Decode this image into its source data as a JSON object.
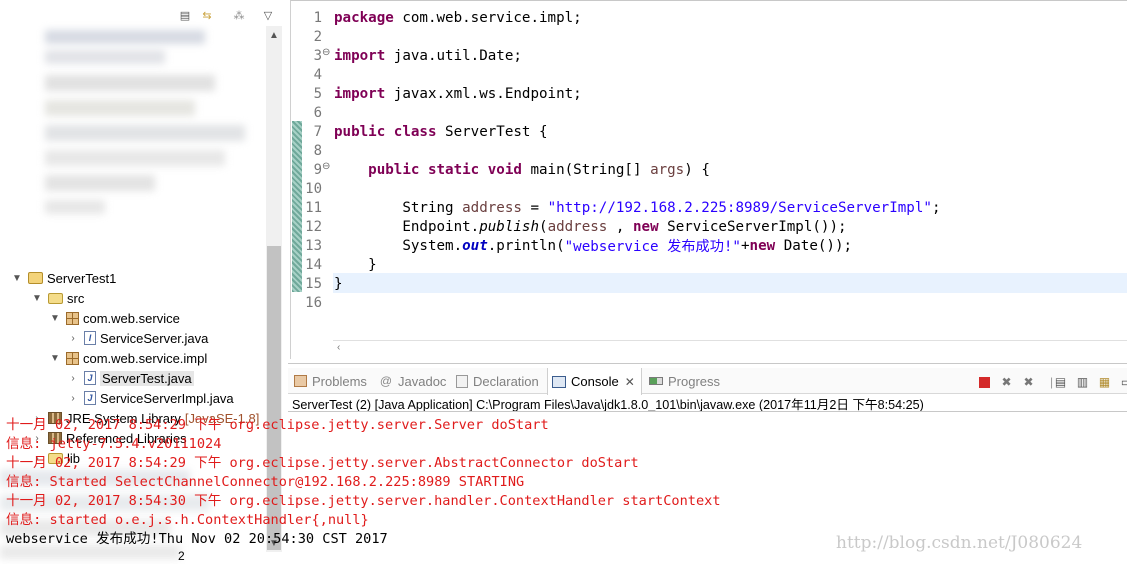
{
  "explorer": {
    "tree": [
      {
        "label": "ServerTest1",
        "icon": "java-project-icon",
        "expanded": true
      },
      {
        "label": "src",
        "icon": "source-folder-icon",
        "expanded": true
      },
      {
        "label": "com.web.service",
        "icon": "package-icon",
        "expanded": true
      },
      {
        "label": "ServiceServer.java",
        "icon": "java-interface-file-icon",
        "expanded": false
      },
      {
        "label": "com.web.service.impl",
        "icon": "package-icon",
        "expanded": true
      },
      {
        "label": "ServerTest.java",
        "icon": "java-file-icon",
        "expanded": false,
        "selected": true
      },
      {
        "label": "ServiceServerImpl.java",
        "icon": "java-file-icon",
        "expanded": false
      },
      {
        "label": "JRE System Library",
        "tag": "[JavaSE-1.8]",
        "icon": "library-icon",
        "expanded": false
      },
      {
        "label": "Referenced Libraries",
        "icon": "library-icon",
        "expanded": false
      },
      {
        "label": "lib",
        "icon": "folder-icon",
        "expanded": false
      }
    ],
    "partial_label": "2"
  },
  "editor": {
    "lines": [
      "1",
      "2",
      "3",
      "4",
      "5",
      "6",
      "7",
      "8",
      "9",
      "10",
      "11",
      "12",
      "13",
      "14",
      "15",
      "16"
    ],
    "code": {
      "l1_kw": "package",
      "l1_rest": " com.web.service.impl;",
      "l3_kw": "import",
      "l3_rest": " java.util.Date;",
      "l5_kw": "import",
      "l5_rest": " javax.xml.ws.Endpoint;",
      "l7_kw1": "public",
      "l7_kw2": "class",
      "l7_rest": " ServerTest {",
      "l9_kw1": "public",
      "l9_kw2": "static",
      "l9_kw3": "void",
      "l9_rest1": " main(String[] ",
      "l9_var": "args",
      "l9_rest2": ") {",
      "l11_a": "String ",
      "l11_var": "address",
      "l11_b": " = ",
      "l11_str": "\"http://192.168.2.225:8989/ServiceServerImpl\"",
      "l11_c": ";",
      "l12_a": "Endpoint.",
      "l12_m": "publish",
      "l12_b": "(",
      "l12_var": "address",
      "l12_c": " , ",
      "l12_kw": "new",
      "l12_d": " ServiceServerImpl());",
      "l13_a": "System.",
      "l13_fld": "out",
      "l13_b": ".println(",
      "l13_str": "\"webservice 发布成功!\"",
      "l13_c": "+",
      "l13_kw": "new",
      "l13_d": " Date());",
      "l14": "}",
      "l15": "}"
    }
  },
  "console": {
    "tabs": [
      {
        "label": "Problems",
        "icon": "problems-icon"
      },
      {
        "label": "Javadoc",
        "icon": "javadoc-icon"
      },
      {
        "label": "Declaration",
        "icon": "declaration-icon"
      },
      {
        "label": "Console",
        "icon": "console-icon",
        "active": true
      },
      {
        "label": "Progress",
        "icon": "progress-icon"
      }
    ],
    "header": "ServerTest (2) [Java Application] C:\\Program Files\\Java\\jdk1.8.0_101\\bin\\javaw.exe (2017年11月2日 下午8:54:25)",
    "log": [
      "十一月 02, 2017 8:54:29 下午 org.eclipse.jetty.server.Server doStart",
      "信息: jetty-7.5.4.v20111024",
      "十一月 02, 2017 8:54:29 下午 org.eclipse.jetty.server.AbstractConnector doStart",
      "信息: Started SelectChannelConnector@192.168.2.225:8989 STARTING",
      "十一月 02, 2017 8:54:30 下午 org.eclipse.jetty.server.handler.ContextHandler startContext",
      "信息: started o.e.j.s.h.ContextHandler{,null}",
      "webservice 发布成功!Thu Nov 02 20:54:30 CST 2017"
    ]
  },
  "watermark": "http://blog.csdn.net/J080624",
  "colors": {
    "keyword": "#7f0055",
    "string": "#2a00ff",
    "stderr": "#e01b1b",
    "current_line": "#e8f2fe"
  }
}
